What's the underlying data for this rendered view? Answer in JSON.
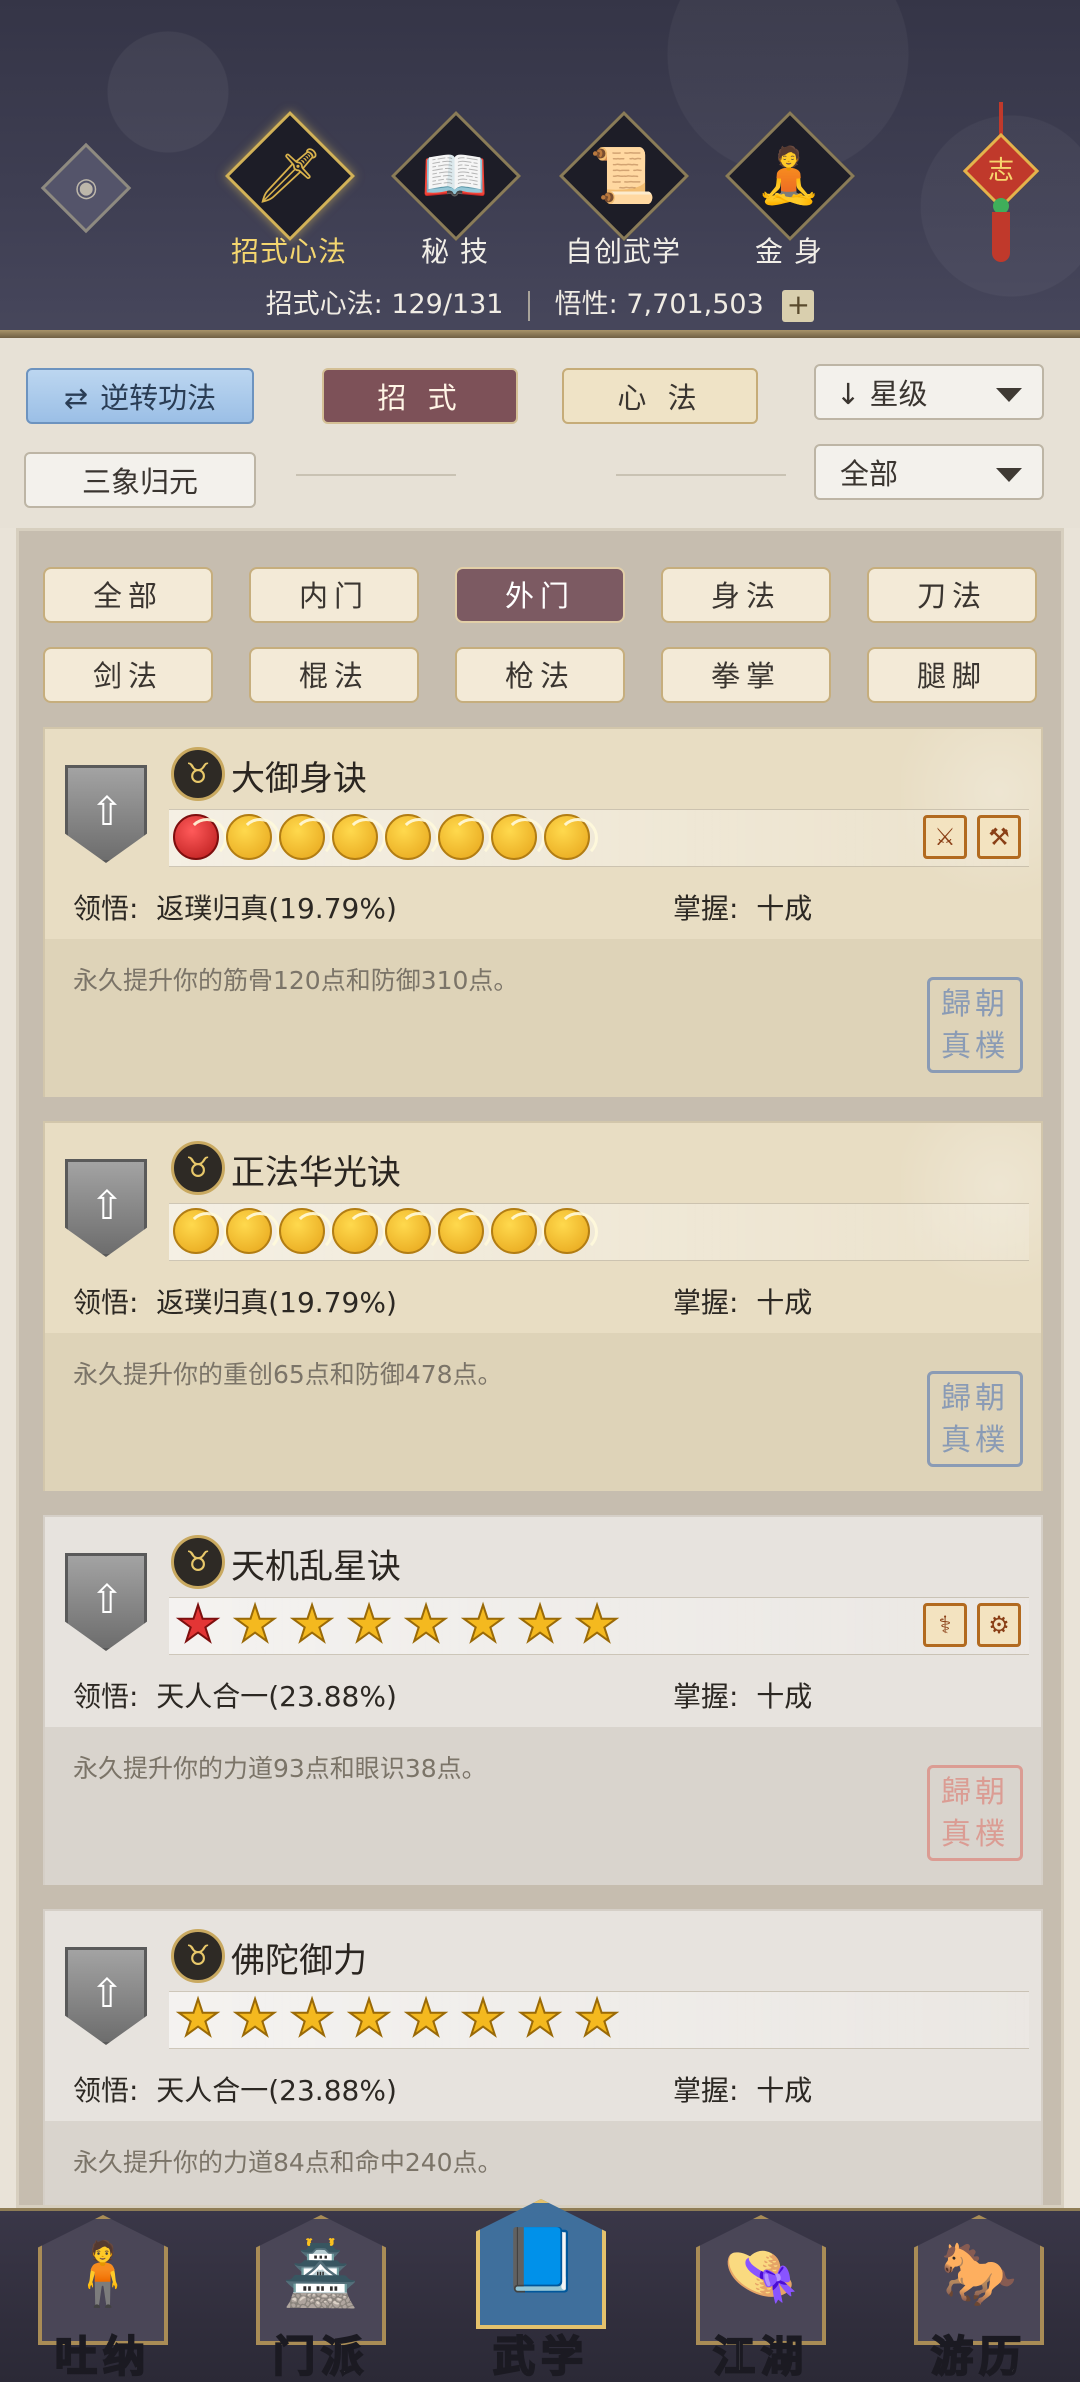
{
  "header": {
    "tabs": [
      {
        "label": "招式心法",
        "glyph": "🗡",
        "active": true
      },
      {
        "label": "秘 技",
        "glyph": "📖",
        "active": false
      },
      {
        "label": "自创武学",
        "glyph": "📜",
        "active": false
      },
      {
        "label": "金 身",
        "glyph": "🧘",
        "active": false
      }
    ],
    "knot_char": "志",
    "stats": {
      "moves_label": "招式心法:",
      "moves_value": "129/131",
      "insight_label": "悟性:",
      "insight_value": "7,701,503",
      "plus": "+"
    }
  },
  "filters": {
    "reverse_btn": "逆转功法",
    "reverse_icon": "⇄",
    "move_btn": "招 式",
    "mind_btn": "心 法",
    "sort_label": "星级",
    "sort_arrow": "↓",
    "three_btn": "三象归元",
    "scope_label": "全部"
  },
  "categories": [
    "全部",
    "内门",
    "外门",
    "身法",
    "刀法",
    "剑法",
    "棍法",
    "枪法",
    "拳掌",
    "腿脚"
  ],
  "active_category": "外门",
  "cards": [
    {
      "title": "大御身诀",
      "rank_type": "moon",
      "icons": [
        "red",
        "gold",
        "gold",
        "gold",
        "gold",
        "gold",
        "gold",
        "gold"
      ],
      "weapons": [
        "⚔",
        "⚒"
      ],
      "insight_label": "领悟:",
      "insight_value": "返璞归真(19.79%)",
      "mastery_label": "掌握:",
      "mastery_value": "十成",
      "desc": "永久提升你的筋骨120点和防御310点。",
      "seal": "歸朝\n真樸",
      "seal_color": "blue",
      "gray": false
    },
    {
      "title": "正法华光诀",
      "rank_type": "moon",
      "icons": [
        "gold",
        "gold",
        "gold",
        "gold",
        "gold",
        "gold",
        "gold",
        "gold"
      ],
      "weapons": [],
      "insight_label": "领悟:",
      "insight_value": "返璞归真(19.79%)",
      "mastery_label": "掌握:",
      "mastery_value": "十成",
      "desc": "永久提升你的重创65点和防御478点。",
      "seal": "歸朝\n真樸",
      "seal_color": "blue",
      "gray": false
    },
    {
      "title": "天机乱星诀",
      "rank_type": "star",
      "icons": [
        "red",
        "gold",
        "gold",
        "gold",
        "gold",
        "gold",
        "gold",
        "gold"
      ],
      "weapons": [
        "⚕",
        "⚙"
      ],
      "insight_label": "领悟:",
      "insight_value": "天人合一(23.88%)",
      "mastery_label": "掌握:",
      "mastery_value": "十成",
      "desc": "永久提升你的力道93点和眼识38点。",
      "seal": "歸朝\n真樸",
      "seal_color": "red",
      "gray": true
    },
    {
      "title": "佛陀御力",
      "rank_type": "star",
      "icons": [
        "gold",
        "gold",
        "gold",
        "gold",
        "gold",
        "gold",
        "gold",
        "gold"
      ],
      "weapons": [],
      "insight_label": "领悟:",
      "insight_value": "天人合一(23.88%)",
      "mastery_label": "掌握:",
      "mastery_value": "十成",
      "desc": "永久提升你的力道84点和命中240点。",
      "seal": "",
      "seal_color": "red",
      "gray": true
    }
  ],
  "bottom_nav": [
    {
      "label": "吐纳",
      "icon": "🧍",
      "active": false
    },
    {
      "label": "门派",
      "icon": "🏯",
      "active": false
    },
    {
      "label": "武学",
      "icon": "📘",
      "active": true
    },
    {
      "label": "江湖",
      "icon": "👒",
      "active": false
    },
    {
      "label": "游历",
      "icon": "🐎",
      "active": false
    }
  ]
}
